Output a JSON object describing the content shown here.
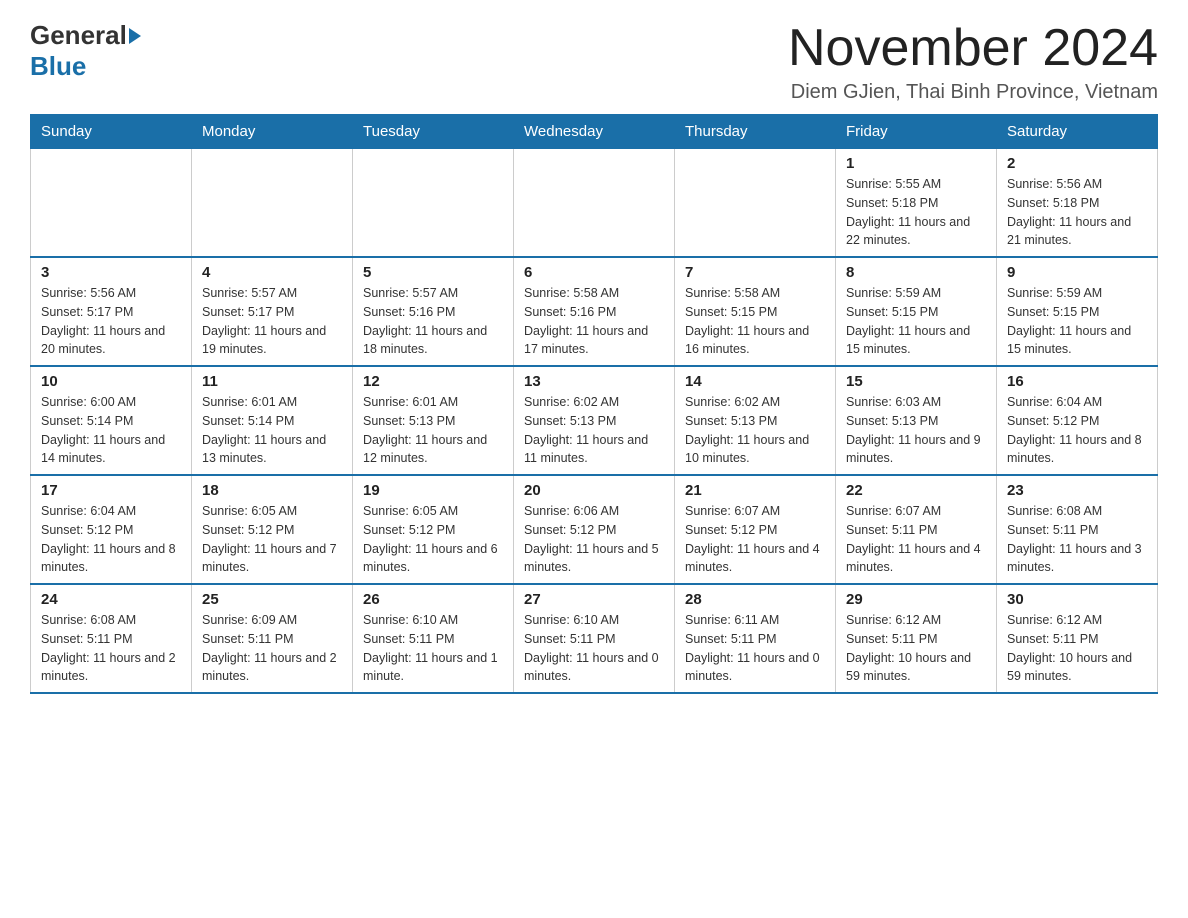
{
  "logo": {
    "general": "General",
    "blue": "Blue"
  },
  "title": "November 2024",
  "location": "Diem GJien, Thai Binh Province, Vietnam",
  "days_of_week": [
    "Sunday",
    "Monday",
    "Tuesday",
    "Wednesday",
    "Thursday",
    "Friday",
    "Saturday"
  ],
  "weeks": [
    [
      {
        "day": "",
        "info": ""
      },
      {
        "day": "",
        "info": ""
      },
      {
        "day": "",
        "info": ""
      },
      {
        "day": "",
        "info": ""
      },
      {
        "day": "",
        "info": ""
      },
      {
        "day": "1",
        "info": "Sunrise: 5:55 AM\nSunset: 5:18 PM\nDaylight: 11 hours and 22 minutes."
      },
      {
        "day": "2",
        "info": "Sunrise: 5:56 AM\nSunset: 5:18 PM\nDaylight: 11 hours and 21 minutes."
      }
    ],
    [
      {
        "day": "3",
        "info": "Sunrise: 5:56 AM\nSunset: 5:17 PM\nDaylight: 11 hours and 20 minutes."
      },
      {
        "day": "4",
        "info": "Sunrise: 5:57 AM\nSunset: 5:17 PM\nDaylight: 11 hours and 19 minutes."
      },
      {
        "day": "5",
        "info": "Sunrise: 5:57 AM\nSunset: 5:16 PM\nDaylight: 11 hours and 18 minutes."
      },
      {
        "day": "6",
        "info": "Sunrise: 5:58 AM\nSunset: 5:16 PM\nDaylight: 11 hours and 17 minutes."
      },
      {
        "day": "7",
        "info": "Sunrise: 5:58 AM\nSunset: 5:15 PM\nDaylight: 11 hours and 16 minutes."
      },
      {
        "day": "8",
        "info": "Sunrise: 5:59 AM\nSunset: 5:15 PM\nDaylight: 11 hours and 15 minutes."
      },
      {
        "day": "9",
        "info": "Sunrise: 5:59 AM\nSunset: 5:15 PM\nDaylight: 11 hours and 15 minutes."
      }
    ],
    [
      {
        "day": "10",
        "info": "Sunrise: 6:00 AM\nSunset: 5:14 PM\nDaylight: 11 hours and 14 minutes."
      },
      {
        "day": "11",
        "info": "Sunrise: 6:01 AM\nSunset: 5:14 PM\nDaylight: 11 hours and 13 minutes."
      },
      {
        "day": "12",
        "info": "Sunrise: 6:01 AM\nSunset: 5:13 PM\nDaylight: 11 hours and 12 minutes."
      },
      {
        "day": "13",
        "info": "Sunrise: 6:02 AM\nSunset: 5:13 PM\nDaylight: 11 hours and 11 minutes."
      },
      {
        "day": "14",
        "info": "Sunrise: 6:02 AM\nSunset: 5:13 PM\nDaylight: 11 hours and 10 minutes."
      },
      {
        "day": "15",
        "info": "Sunrise: 6:03 AM\nSunset: 5:13 PM\nDaylight: 11 hours and 9 minutes."
      },
      {
        "day": "16",
        "info": "Sunrise: 6:04 AM\nSunset: 5:12 PM\nDaylight: 11 hours and 8 minutes."
      }
    ],
    [
      {
        "day": "17",
        "info": "Sunrise: 6:04 AM\nSunset: 5:12 PM\nDaylight: 11 hours and 8 minutes."
      },
      {
        "day": "18",
        "info": "Sunrise: 6:05 AM\nSunset: 5:12 PM\nDaylight: 11 hours and 7 minutes."
      },
      {
        "day": "19",
        "info": "Sunrise: 6:05 AM\nSunset: 5:12 PM\nDaylight: 11 hours and 6 minutes."
      },
      {
        "day": "20",
        "info": "Sunrise: 6:06 AM\nSunset: 5:12 PM\nDaylight: 11 hours and 5 minutes."
      },
      {
        "day": "21",
        "info": "Sunrise: 6:07 AM\nSunset: 5:12 PM\nDaylight: 11 hours and 4 minutes."
      },
      {
        "day": "22",
        "info": "Sunrise: 6:07 AM\nSunset: 5:11 PM\nDaylight: 11 hours and 4 minutes."
      },
      {
        "day": "23",
        "info": "Sunrise: 6:08 AM\nSunset: 5:11 PM\nDaylight: 11 hours and 3 minutes."
      }
    ],
    [
      {
        "day": "24",
        "info": "Sunrise: 6:08 AM\nSunset: 5:11 PM\nDaylight: 11 hours and 2 minutes."
      },
      {
        "day": "25",
        "info": "Sunrise: 6:09 AM\nSunset: 5:11 PM\nDaylight: 11 hours and 2 minutes."
      },
      {
        "day": "26",
        "info": "Sunrise: 6:10 AM\nSunset: 5:11 PM\nDaylight: 11 hours and 1 minute."
      },
      {
        "day": "27",
        "info": "Sunrise: 6:10 AM\nSunset: 5:11 PM\nDaylight: 11 hours and 0 minutes."
      },
      {
        "day": "28",
        "info": "Sunrise: 6:11 AM\nSunset: 5:11 PM\nDaylight: 11 hours and 0 minutes."
      },
      {
        "day": "29",
        "info": "Sunrise: 6:12 AM\nSunset: 5:11 PM\nDaylight: 10 hours and 59 minutes."
      },
      {
        "day": "30",
        "info": "Sunrise: 6:12 AM\nSunset: 5:11 PM\nDaylight: 10 hours and 59 minutes."
      }
    ]
  ]
}
